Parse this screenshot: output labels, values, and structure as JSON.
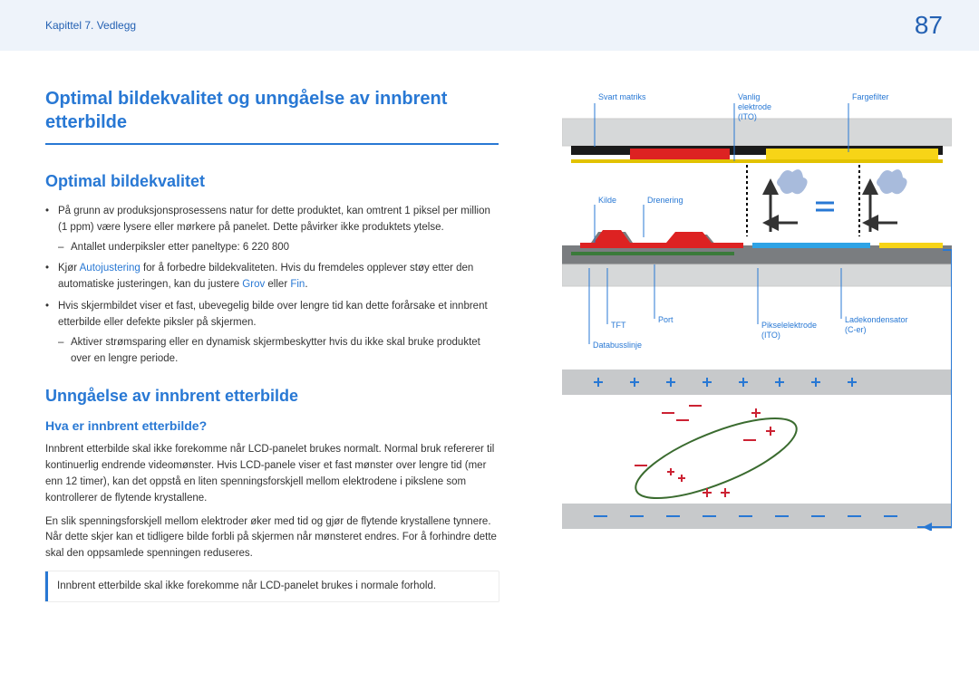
{
  "header": {
    "breadcrumb": "Kapittel 7. Vedlegg",
    "page": "87"
  },
  "title": "Optimal bildekvalitet og unngåelse av innbrent etterbilde",
  "section1": {
    "heading": "Optimal bildekvalitet",
    "bullet1": "På grunn av produksjonsprosessens natur for dette produktet, kan omtrent 1 piksel per million (1 ppm) være lysere eller mørkere på panelet. Dette påvirker ikke produktets ytelse.",
    "dash1": "Antallet underpiksler etter paneltype: 6 220 800",
    "bullet2a": "Kjør ",
    "bullet2_hl1": "Autojustering",
    "bullet2b": " for å forbedre bildekvaliteten. Hvis du fremdeles opplever støy etter den automatiske justeringen, kan du justere ",
    "bullet2_hl2": "Grov",
    "bullet2c": " eller ",
    "bullet2_hl3": "Fin",
    "bullet2d": ".",
    "bullet3": "Hvis skjermbildet viser et fast, ubevegelig bilde over lengre tid kan dette forårsake et innbrent etterbilde eller defekte piksler på skjermen.",
    "dash3": "Aktiver strømsparing eller en dynamisk skjermbeskytter hvis du ikke skal bruke produktet over en lengre periode."
  },
  "section2": {
    "heading": "Unngåelse av innbrent etterbilde",
    "sub": "Hva er innbrent etterbilde?",
    "p1": "Innbrent etterbilde skal ikke forekomme når LCD-panelet brukes normalt. Normal bruk refererer til kontinuerlig endrende videomønster. Hvis LCD-panele viser et fast mønster over lengre tid (mer enn 12 timer), kan det oppstå en liten spenningsforskjell mellom elektrodene i pikslene som kontrollerer de flytende krystallene.",
    "p2": "En slik spenningsforskjell mellom elektroder øker med tid og gjør de flytende krystallene tynnere. Når dette skjer kan et tidligere bilde forbli på skjermen når mønsteret endres. For å forhindre dette skal den oppsamlede spenningen reduseres.",
    "note": "Innbrent etterbilde skal ikke forekomme når LCD-panelet brukes i normale forhold."
  },
  "diagram_labels": {
    "svart_matriks": "Svart matriks",
    "vanlig_elektrode": "Vanlig elektrode (ITO)",
    "fargefilter": "Fargefilter",
    "kilde": "Kilde",
    "drenering": "Drenering",
    "tft": "TFT",
    "port": "Port",
    "databusslinje": "Databusslinje",
    "pikselelektrode": "Pikselelektrode (ITO)",
    "ladekondensator": "Ladekondensator (C-er)"
  }
}
